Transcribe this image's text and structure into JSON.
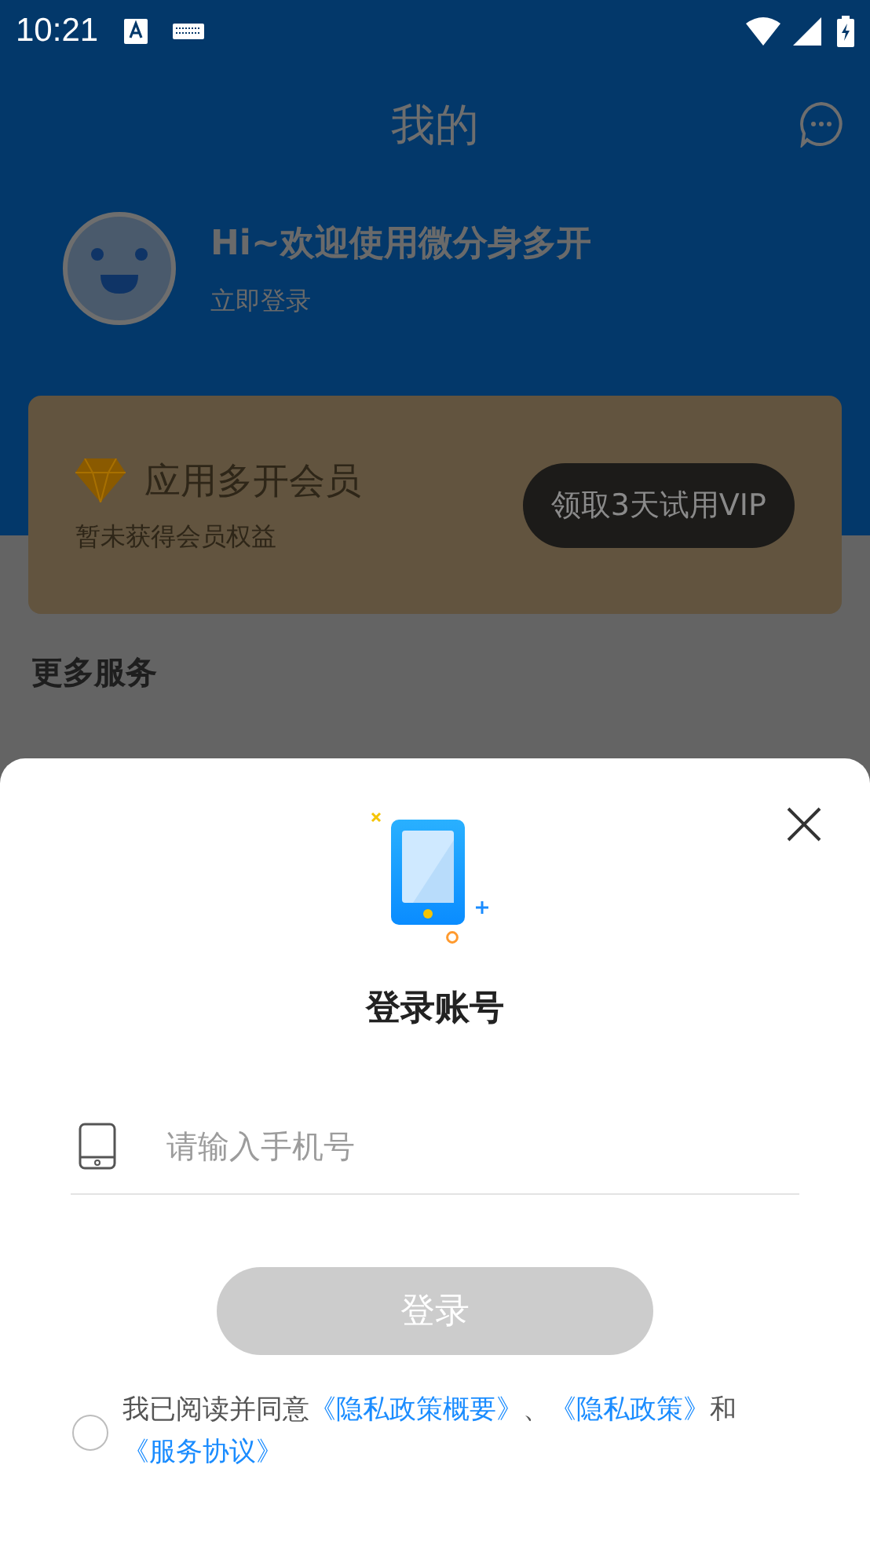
{
  "status_bar": {
    "time": "10:21"
  },
  "header": {
    "title": "我的"
  },
  "profile": {
    "greeting": "Hi~欢迎使用微分身多开",
    "login_link": "立即登录"
  },
  "vip_card": {
    "title": "应用多开会员",
    "subtitle": "暂未获得会员权益",
    "button": "领取3天试用VIP"
  },
  "section_title": "更多服务",
  "login_sheet": {
    "title": "登录账号",
    "phone_field": {
      "placeholder": "请输入手机号"
    },
    "login_button": {
      "label": "登录",
      "disabled": true
    },
    "agreement": {
      "checked": false,
      "parts": [
        {
          "kind": "text",
          "text": "我已阅读并同意"
        },
        {
          "kind": "link",
          "text": "《隐私政策概要》"
        },
        {
          "kind": "text",
          "text": "、"
        },
        {
          "kind": "link",
          "text": "《隐私政策》"
        },
        {
          "kind": "text",
          "text": "和"
        },
        {
          "kind": "link",
          "text": "《服务协议》"
        }
      ]
    }
  }
}
